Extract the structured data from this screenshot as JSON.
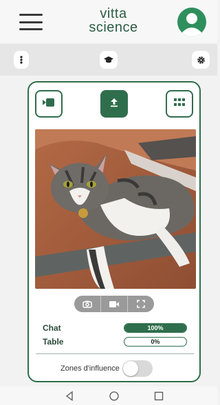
{
  "header": {
    "logo_line1": "vitta",
    "logo_line2": "science",
    "menu_icon": "hamburger-menu-icon",
    "account_icon": "user-account-icon"
  },
  "toolbar": {
    "left_icon": "vertical-dots-icon",
    "center_icon": "graduation-cap-icon",
    "right_icon": "gear-icon"
  },
  "card": {
    "buttons": [
      {
        "icon": "video-input-icon",
        "active": false
      },
      {
        "icon": "upload-icon",
        "active": true
      },
      {
        "icon": "grid-icon",
        "active": false
      }
    ],
    "camera_controls": [
      "camera-icon",
      "video-camera-icon",
      "fullscreen-icon"
    ],
    "results": [
      {
        "label": "Chat",
        "value_text": "100%",
        "value": 100
      },
      {
        "label": "Table",
        "value_text": "0%",
        "value": 0
      }
    ],
    "zones_label": "Zones d'influence",
    "zones_enabled": false
  },
  "navbar": {
    "back_icon": "back-triangle-icon",
    "home_icon": "home-circle-icon",
    "recents_icon": "recents-square-icon"
  },
  "colors": {
    "accent": "#2f6e4c",
    "avatar": "#2f8f5c",
    "toolbar_bg": "#e6e6e6"
  }
}
